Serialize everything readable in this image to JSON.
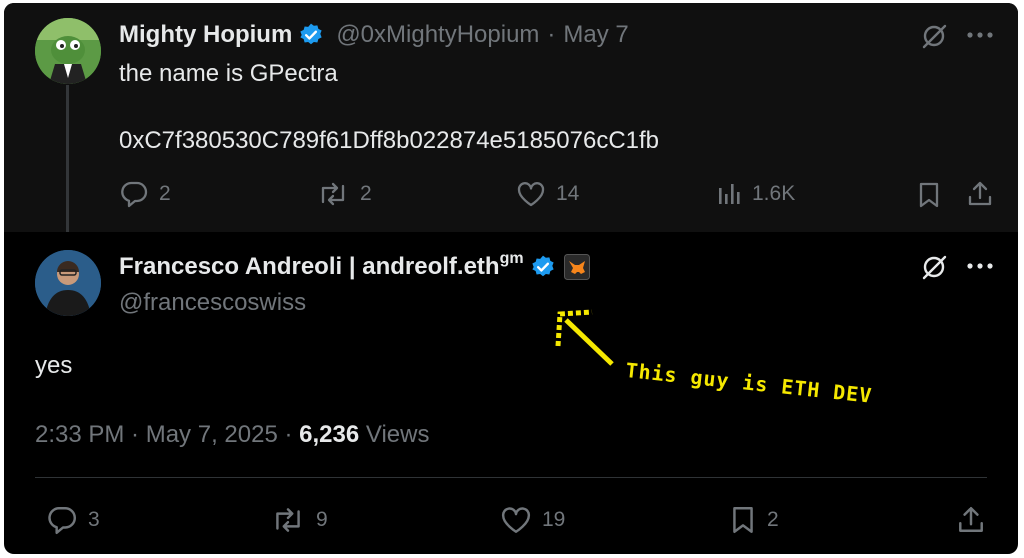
{
  "top_post": {
    "display_name": "Mighty Hopium",
    "handle": "@0xMightyHopium",
    "separator": "·",
    "date": "May 7",
    "line1": "the name is GPectra",
    "line2": "0xC7f380530C789f61Dff8b022874e5185076cC1fb",
    "replies": "2",
    "reposts": "2",
    "likes": "14",
    "views": "1.6K"
  },
  "main_post": {
    "display_name": "Francesco Andreoli | andreolf.eth",
    "name_suffix": "gm",
    "handle": "@francescoswiss",
    "text": "yes",
    "time": "2:33 PM",
    "date": "May 7, 2025",
    "views_count": "6,236",
    "views_label": "Views",
    "meta_separator": " · ",
    "replies": "3",
    "reposts": "9",
    "likes": "19",
    "bookmarks": "2"
  },
  "annotation": {
    "text": "This guy is ETH DEV",
    "color": "#f5e800"
  },
  "colors": {
    "verified": "#1d9bf0",
    "muted": "#71767b",
    "text": "#e7e9ea",
    "background": "#000000"
  }
}
